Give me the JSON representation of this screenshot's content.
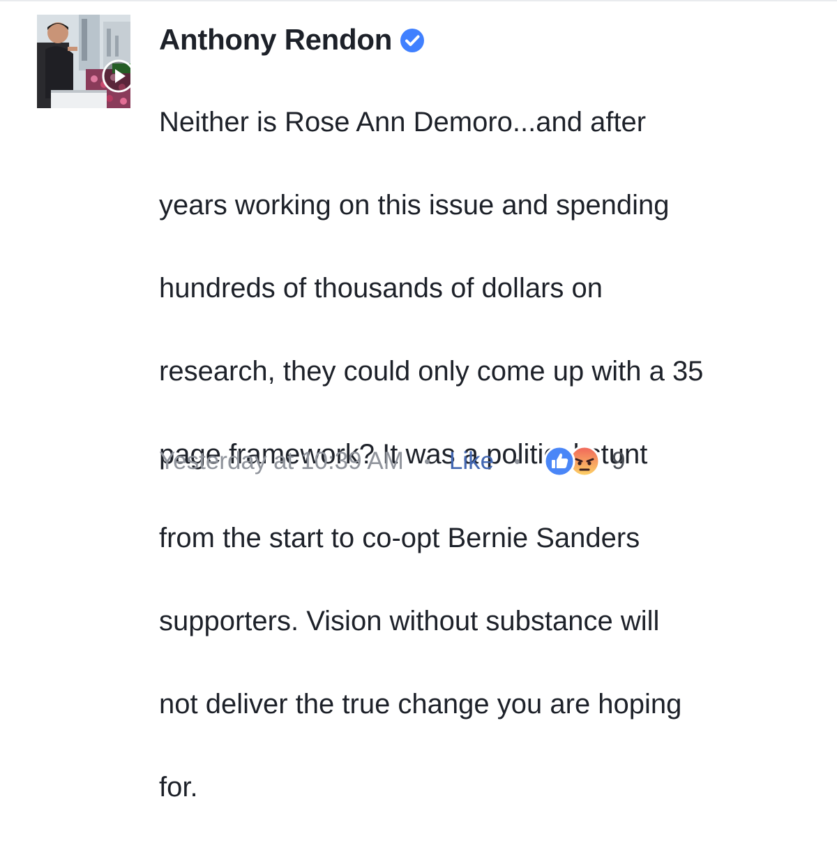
{
  "comment": {
    "author": "Anthony Rendon",
    "text_lines": [
      "Neither is Rose Ann Demoro...and after",
      "years working on this issue and spending",
      "hundreds of thousands of dollars on",
      "research, they could only come up with a 35",
      "page framework?  It was a political stunt",
      "from the start to co-opt Bernie Sanders",
      "supporters.  Vision without substance will",
      "not deliver the true change you are hoping",
      "for."
    ],
    "timestamp": "Yesterday at 10:39 AM",
    "like_label": "Like",
    "reaction_count": "9",
    "reactions": [
      "like-reaction-icon",
      "angry-reaction-icon"
    ],
    "verified_icon": "verified-badge-icon",
    "avatar_icon": "video-play-icon"
  },
  "colors": {
    "text": "#1d2129",
    "meta": "#90949c",
    "link": "#4267b2",
    "verified": "#4080ff",
    "angry": "#f0645a"
  }
}
